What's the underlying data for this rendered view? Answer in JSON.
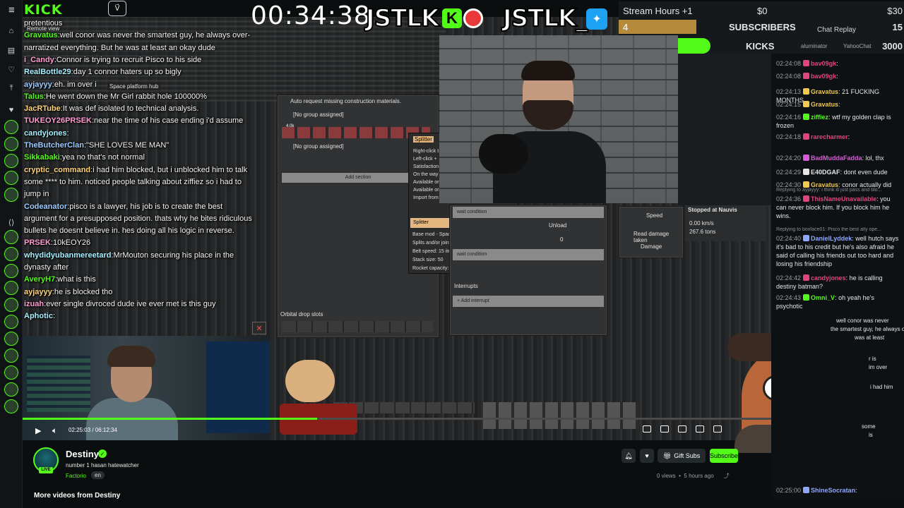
{
  "app": {
    "logo": "KICK",
    "menu_icon": "menu-icon",
    "app_icon_label": "V⃗"
  },
  "stream_overlay": {
    "timer": "00:34:38",
    "brand_left": "JSTLK",
    "brand_right": "JSTLK_",
    "stats": {
      "stream_hours_label": "Stream Hours +1",
      "stream_hours_value": "$0",
      "stream_hours_goal": "$30",
      "subs_count": "4",
      "subs_label": "SUBSCRIBERS",
      "subs_goal": "15",
      "kicks_value": "1000",
      "kicks_label": "KICKS",
      "kicks_goal": "3000",
      "kicks_user1": "aluminator",
      "kicks_user2": "YahooChat"
    },
    "chat_replay_label": "Chat Replay"
  },
  "overlay_chat": [
    {
      "user": "",
      "text": "pretentious"
    },
    {
      "user": "Gravatus",
      "text": "well conor was never the smartest guy, he always over-"
    },
    {
      "user": "",
      "text": "narratized everything. But he was at least an okay dude"
    },
    {
      "user": "i_Candy",
      "text": "Connor is trying to recruit Pisco to his side"
    },
    {
      "user": "RealBottle29",
      "text": "day 1 connor haters up so bigly"
    },
    {
      "user": "ayjayyy",
      "text": "eh. im over i"
    },
    {
      "user": "Talus",
      "text": "He went down the Mr Girl rabbit hole 100000%"
    },
    {
      "user": "JacRTube",
      "text": "It was def isolated to technical analysis."
    },
    {
      "user": "TUKEOY26PRSEK",
      "text": "near the time of his case ending i'd assume"
    },
    {
      "user": "candyjones",
      "text": ""
    },
    {
      "user": "TheButcherClan",
      "text": "\"SHE LOVES ME MAN\""
    },
    {
      "user": "Sikkabaki",
      "text": "yea no that's not normal"
    },
    {
      "user": "cryptic_command",
      "text": "i had him blocked, but i unblocked him to talk"
    },
    {
      "user": "",
      "text": "some **** to him. noticed people talking about ziffiez so i had to"
    },
    {
      "user": "",
      "text": "jump in"
    },
    {
      "user": "Codeanator",
      "text": "pisco is a lawyer, his job is to create the best"
    },
    {
      "user": "",
      "text": "argument for a presupposed position. thats why he bites ridiculous"
    },
    {
      "user": "",
      "text": "bullets he doesnt believe in. hes doing all his logic in reverse."
    },
    {
      "user": "PRSEK",
      "text": "10kEOY26"
    },
    {
      "user": "whydidyubanmereetard",
      "text": "MrMouton securing his place in the"
    },
    {
      "user": "",
      "text": "dynasty after"
    },
    {
      "user": "AveryH7",
      "text": "what is this"
    },
    {
      "user": "ayjayyy",
      "text": "he is blocked tho"
    },
    {
      "user": "izuah",
      "text": "ever single divroced dude ive ever met is this guy"
    },
    {
      "user": "Aphotic",
      "text": ""
    }
  ],
  "game_ui": {
    "hub_title": "Space platform hub",
    "auto_request": "Auto request missing construction materials.",
    "group1": "[No group assigned]",
    "group2": "[No group assigned]",
    "slot_amount": "4.0k",
    "add_section": "Add section",
    "orbital_drop": "Orbital drop slots",
    "tooltip_title": "Splitter",
    "tooltip_source": "Base mod - Space Age",
    "tooltip_desc": "Splits and/or joins transport belts' cargo 1:1",
    "tooltip_speed": "Belt speed: 15 items/s",
    "tooltip_stack": "Stack size: 50",
    "tooltip_rocket": "Rocket capacity: 50",
    "menu_items": [
      "Right-click t",
      "Left-click +",
      "Satisfaction",
      "On the way",
      "Available on",
      "Available on",
      "Import from"
    ],
    "wait_condition": "wait condition",
    "unload": "Unload",
    "interrupts": "Interrupts",
    "add_interrupt": "+ Add interrupt",
    "speed_label": "Speed",
    "damage_label": "Damage",
    "read_damage": "Read damage taken",
    "stopped_at": "Stopped at Nauvis",
    "speed_val": "0.00 km/s",
    "weight_val": "267.6 tons",
    "remote_view": "Remote view",
    "zero": "0"
  },
  "player": {
    "time_current": "02:25:03",
    "time_total": "06:12:34",
    "progress": 0.39
  },
  "chat": [
    {
      "time": "02:24:08",
      "user": "bav09gk",
      "text": "",
      "color": "#e0457b"
    },
    {
      "time": "02:24:08",
      "user": "bav09gk",
      "text": "",
      "color": "#e0457b"
    },
    {
      "time": "02:24:13",
      "user": "Gravatus",
      "text": "21 FUCKING MONTHS",
      "color": "#f2c94c"
    },
    {
      "time": "02:24:15",
      "user": "Gravatus",
      "text": "",
      "color": "#f2c94c"
    },
    {
      "time": "02:24:16",
      "user": "ziffiez",
      "text": "wtf my golden clap is frozen",
      "color": "#53fc18"
    },
    {
      "time": "02:24:18",
      "user": "rarecharmer",
      "text": "",
      "color": "#e0457b"
    },
    {
      "time": "02:24:20",
      "user": "BadMuddaFadda",
      "text": "lol, thx",
      "color": "#d65bd6"
    },
    {
      "time": "02:24:29",
      "user": "E40DGAF",
      "text": "dont even dude",
      "color": "#e6e6e6"
    },
    {
      "time": "02:24:30",
      "user": "Gravatus",
      "text": "conor actually did",
      "color": "#f2c94c"
    },
    {
      "time": "02:24:36",
      "user": "ThisNameUnavailable",
      "text": "you can never block him. If you block him he wins.",
      "color": "#e0457b"
    },
    {
      "time": "02:24:40",
      "user": "DanielLyddek",
      "text": "well hutch says it's bad to his credit but he's also afraid he said of calling his friends out too hard and losing his friendship",
      "color": "#8fa7ff"
    },
    {
      "time": "02:24:42",
      "user": "candyjones",
      "text": "he is calling destiny batman?",
      "color": "#e0457b"
    },
    {
      "time": "02:24:43",
      "user": "Omni_V",
      "text": "oh yeah he's psychotic",
      "color": "#53fc18"
    },
    {
      "time": "02:25:00",
      "user": "ShineSocratan",
      "text": "",
      "color": "#8fa7ff"
    }
  ],
  "chat_replies": [
    "Replying to ayjayyy: i think ill just pass and blo...",
    "Replying to boxface01: Pisco the best ally ope..."
  ],
  "chat_overflow": [
    "well conor was never",
    "the smartest guy, he always over-",
    "was at least",
    "r is",
    "im over",
    "i had him",
    "some",
    "is"
  ],
  "channel": {
    "name": "Destiny",
    "title": "number 1 hasan hatewatcher",
    "category": "Factorio",
    "language": "en",
    "live": "LIVE",
    "views": "0 views",
    "age": "5 hours ago",
    "gift_subs": "Gift Subs",
    "subscribe": "Subscribe",
    "more_videos": "More videos from Destiny"
  },
  "colors": {
    "accent": "#53fc18",
    "bg": "#0b0e0f",
    "panel": "#313233"
  }
}
